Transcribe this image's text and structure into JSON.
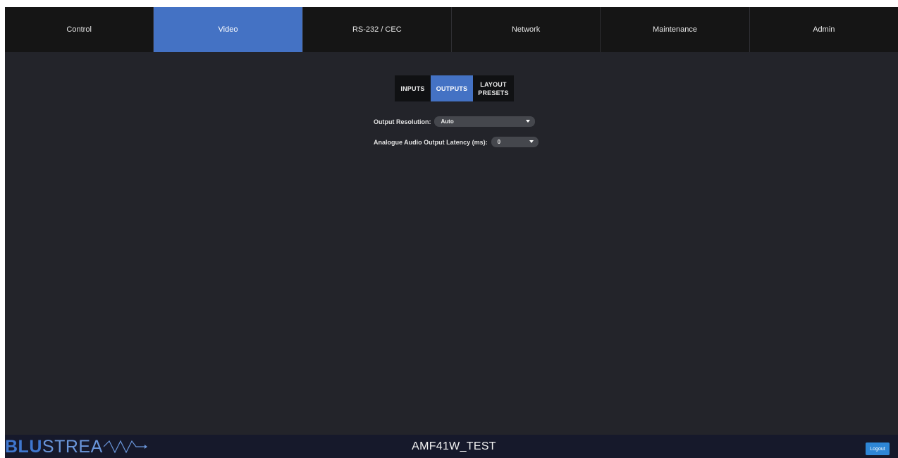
{
  "nav": {
    "tabs": [
      {
        "label": "Control"
      },
      {
        "label": "Video"
      },
      {
        "label": "RS-232 / CEC"
      },
      {
        "label": "Network"
      },
      {
        "label": "Maintenance"
      },
      {
        "label": "Admin"
      }
    ],
    "active": "Video"
  },
  "subtabs": {
    "inputs": "INPUTS",
    "outputs": "OUTPUTS",
    "layout_line1": "LAYOUT",
    "layout_line2": "PRESETS",
    "active": "OUTPUTS"
  },
  "form": {
    "output_resolution_label": "Output Resolution:",
    "output_resolution_value": "Auto",
    "audio_latency_label": "Analogue Audio Output Latency (ms):",
    "audio_latency_value": "0"
  },
  "footer": {
    "logo_bold": "BLU",
    "logo_light": "STREA",
    "device_name": "AMF41W_TEST",
    "logout_label": "Logout"
  },
  "colors": {
    "accent": "#4472c4",
    "background": "#23242a",
    "nav_background": "#151515",
    "footer_background": "#16192b",
    "logout_button": "#2e86d6"
  },
  "icons": {
    "dropdown": "caret-down-icon",
    "logo_wave": "wave-arrow-icon"
  }
}
